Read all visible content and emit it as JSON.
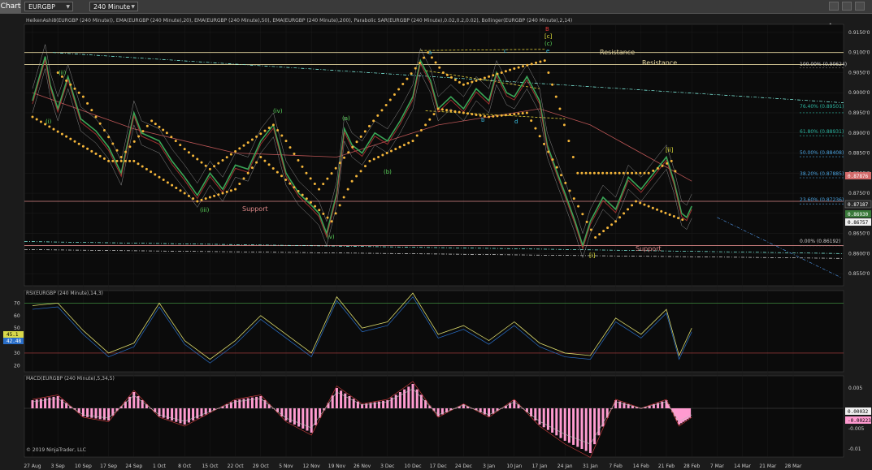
{
  "toolbar": {
    "tab_label": "Chart",
    "instrument": "EURGBP",
    "timeframe": "240 Minute"
  },
  "main_panel": {
    "indicator_header": "HeikenAshi8(EURGBP (240 Minute)), EMA(EURGBP (240 Minute),20), EMA(EURGBP (240 Minute),50), EMA(EURGBP (240 Minute),200), Parabolic SAR(EURGBP (240 Minute),0.02,0.2,0.02), Bollinger(EURGBP (240 Minute),2,14)",
    "y_ticks": [
      "0.9150'0",
      "0.9100'0",
      "0.9050'0",
      "0.9000'0",
      "0.8950'0",
      "0.8900'0",
      "0.8850'0",
      "0.8800'0",
      "0.8750'0",
      "0.8700'0",
      "0.8650'0",
      "0.8600'0",
      "0.8550'0"
    ],
    "price_labels": [
      "0.87876",
      "0.87187",
      "0.86930",
      "0.86757"
    ],
    "fib_levels": [
      {
        "label": "100.00% (0.90624)"
      },
      {
        "label": "76.40% (0.89501)"
      },
      {
        "label": "61.80% (0.88931)"
      },
      {
        "label": "50.00% (0.88408)"
      },
      {
        "label": "38.20% (0.87885)"
      },
      {
        "label": "23.60% (0.87236)"
      },
      {
        "label": "0.00% (0.86192)"
      }
    ],
    "lines": {
      "resistance_1": "Resistance",
      "resistance_2": "Resistance",
      "support_1": "Support",
      "support_2": "Support"
    },
    "wave_labels": {
      "i_top": "(i)",
      "i_bottom": "(ii)",
      "iii": "(iii)",
      "iv": "(iv)",
      "v": "(v)",
      "a": "(a)",
      "b": "(b)",
      "cyan_a": "a",
      "cyan_c": "c",
      "cyan_e": "e",
      "cyan_b": "b",
      "cyan_d": "d",
      "red_B": "B",
      "c_bracket": "[c]",
      "c_paren": "(c)",
      "i_bracket": "[i]",
      "ii_bracket": "[ii]"
    },
    "colors": {
      "sar": "#f5b63a",
      "support_line": "#d88",
      "resistance_line": "#e6d7a0",
      "trend_line": "#8fe",
      "fib_text": "#4aa3df",
      "wave_green": "#5cd65c",
      "wave_cyan": "#3cc3e6",
      "wave_red": "#e63c3c",
      "wave_yellow": "#e6e63c"
    }
  },
  "rsi_panel": {
    "title": "RSI(EURGBP (240 Minute),14,3)",
    "y_ticks": [
      "70",
      "60",
      "50",
      "40",
      "30",
      "20"
    ],
    "value_a": "45.1",
    "value_b": "42.48"
  },
  "macd_panel": {
    "title": "MACD(EURGBP (240 Minute),5,34,5)",
    "y_ticks": [
      "0.005",
      "-0.005",
      "-0.01"
    ],
    "value_a": "0.00032",
    "value_b": "-0.00223"
  },
  "copyright": "© 2019 NinjaTrader, LLC",
  "x_axis": {
    "ticks": [
      "27 Aug",
      "3 Sep",
      "10 Sep",
      "17 Sep",
      "24 Sep",
      "1 Oct",
      "8 Oct",
      "15 Oct",
      "22 Oct",
      "29 Oct",
      "5 Nov",
      "12 Nov",
      "19 Nov",
      "26 Nov",
      "3 Dec",
      "10 Dec",
      "17 Dec",
      "24 Dec",
      "3 Jan",
      "10 Jan",
      "17 Jan",
      "24 Jan",
      "31 Jan",
      "7 Feb",
      "14 Feb",
      "21 Feb",
      "28 Feb",
      "7 Mar",
      "14 Mar",
      "21 Mar",
      "28 Mar"
    ]
  },
  "chart_data": {
    "type": "line",
    "instrument": "EURGBP",
    "timeframe": "240 Minute",
    "x_unit": "weeks from 27 Aug",
    "price_path": [
      [
        0,
        0.898
      ],
      [
        0.5,
        0.909
      ],
      [
        0.7,
        0.902
      ],
      [
        1,
        0.896
      ],
      [
        1.4,
        0.904
      ],
      [
        1.9,
        0.8935
      ],
      [
        2.5,
        0.8905
      ],
      [
        3,
        0.8865
      ],
      [
        3.5,
        0.88
      ],
      [
        4,
        0.895
      ],
      [
        4.3,
        0.89
      ],
      [
        5,
        0.888
      ],
      [
        5.5,
        0.883
      ],
      [
        6,
        0.879
      ],
      [
        6.5,
        0.8745
      ],
      [
        7,
        0.88
      ],
      [
        7.5,
        0.876
      ],
      [
        8,
        0.882
      ],
      [
        8.5,
        0.881
      ],
      [
        9,
        0.888
      ],
      [
        9.5,
        0.892
      ],
      [
        10,
        0.88
      ],
      [
        10.5,
        0.875
      ],
      [
        11,
        0.872
      ],
      [
        11.3,
        0.87
      ],
      [
        11.6,
        0.865
      ],
      [
        12,
        0.875
      ],
      [
        12.3,
        0.891
      ],
      [
        12.6,
        0.887
      ],
      [
        13,
        0.885
      ],
      [
        13.5,
        0.89
      ],
      [
        14,
        0.888
      ],
      [
        14.5,
        0.893
      ],
      [
        15,
        0.899
      ],
      [
        15.3,
        0.908
      ],
      [
        15.7,
        0.903
      ],
      [
        16,
        0.896
      ],
      [
        16.5,
        0.899
      ],
      [
        17,
        0.896
      ],
      [
        17.5,
        0.901
      ],
      [
        18,
        0.898
      ],
      [
        18.3,
        0.905
      ],
      [
        18.7,
        0.9
      ],
      [
        19,
        0.899
      ],
      [
        19.5,
        0.904
      ],
      [
        20,
        0.898
      ],
      [
        20.3,
        0.887
      ],
      [
        20.7,
        0.88
      ],
      [
        21,
        0.875
      ],
      [
        21.4,
        0.868
      ],
      [
        21.7,
        0.862
      ],
      [
        22,
        0.868
      ],
      [
        22.5,
        0.874
      ],
      [
        23,
        0.871
      ],
      [
        23.5,
        0.879
      ],
      [
        24,
        0.876
      ],
      [
        24.5,
        0.88
      ],
      [
        25,
        0.884
      ],
      [
        25.3,
        0.878
      ],
      [
        25.6,
        0.87
      ],
      [
        25.8,
        0.869
      ],
      [
        26,
        0.8718
      ]
    ],
    "sar_upper": [
      [
        1,
        0.905
      ],
      [
        1.5,
        0.902
      ],
      [
        2,
        0.899
      ],
      [
        3.5,
        0.884
      ],
      [
        4.7,
        0.893
      ],
      [
        5.3,
        0.89
      ],
      [
        6,
        0.886
      ],
      [
        7,
        0.881
      ],
      [
        9.5,
        0.892
      ],
      [
        10,
        0.888
      ],
      [
        10.8,
        0.88
      ],
      [
        11.3,
        0.876
      ],
      [
        15.6,
        0.91
      ],
      [
        16.2,
        0.905
      ],
      [
        17,
        0.902
      ],
      [
        18,
        0.904
      ],
      [
        19,
        0.906
      ],
      [
        20.2,
        0.908
      ],
      [
        20.8,
        0.896
      ],
      [
        21.5,
        0.88
      ],
      [
        24.3,
        0.88
      ],
      [
        25.2,
        0.883
      ],
      [
        25.5,
        0.878
      ]
    ],
    "sar_lower": [
      [
        0,
        0.894
      ],
      [
        3,
        0.883
      ],
      [
        4,
        0.883
      ],
      [
        6.5,
        0.873
      ],
      [
        8,
        0.876
      ],
      [
        9,
        0.884
      ],
      [
        11.8,
        0.868
      ],
      [
        12.6,
        0.878
      ],
      [
        13.3,
        0.883
      ],
      [
        15,
        0.888
      ],
      [
        16,
        0.896
      ],
      [
        18,
        0.894
      ],
      [
        19.5,
        0.895
      ],
      [
        22.2,
        0.864
      ],
      [
        23,
        0.868
      ],
      [
        23.8,
        0.873
      ],
      [
        25.8,
        0.868
      ]
    ],
    "ema_200": [
      [
        0,
        0.9
      ],
      [
        4,
        0.891
      ],
      [
        8,
        0.885
      ],
      [
        12,
        0.884
      ],
      [
        16,
        0.892
      ],
      [
        20,
        0.896
      ],
      [
        22,
        0.892
      ],
      [
        24,
        0.885
      ],
      [
        26,
        0.878
      ]
    ],
    "resistance_levels": [
      0.91,
      0.907
    ],
    "support_levels": [
      0.873,
      0.862
    ],
    "rsi": [
      [
        0,
        68
      ],
      [
        1,
        70
      ],
      [
        2,
        48
      ],
      [
        3,
        30
      ],
      [
        4,
        38
      ],
      [
        5,
        70
      ],
      [
        6,
        40
      ],
      [
        7,
        25
      ],
      [
        8,
        40
      ],
      [
        9,
        60
      ],
      [
        10,
        45
      ],
      [
        11,
        30
      ],
      [
        12,
        75
      ],
      [
        13,
        50
      ],
      [
        14,
        55
      ],
      [
        15,
        78
      ],
      [
        16,
        45
      ],
      [
        17,
        52
      ],
      [
        18,
        40
      ],
      [
        19,
        55
      ],
      [
        20,
        38
      ],
      [
        21,
        30
      ],
      [
        22,
        28
      ],
      [
        23,
        58
      ],
      [
        24,
        45
      ],
      [
        25,
        65
      ],
      [
        25.5,
        28
      ],
      [
        26,
        50
      ]
    ],
    "macd": [
      [
        0,
        0.002
      ],
      [
        1,
        0.003
      ],
      [
        2,
        -0.002
      ],
      [
        3,
        -0.003
      ],
      [
        4,
        0.004
      ],
      [
        5,
        -0.002
      ],
      [
        6,
        -0.004
      ],
      [
        7,
        -0.001
      ],
      [
        8,
        0.002
      ],
      [
        9,
        0.003
      ],
      [
        10,
        -0.003
      ],
      [
        11,
        -0.006
      ],
      [
        12,
        0.005
      ],
      [
        13,
        0.001
      ],
      [
        14,
        0.002
      ],
      [
        15,
        0.006
      ],
      [
        16,
        -0.002
      ],
      [
        17,
        0.001
      ],
      [
        18,
        -0.002
      ],
      [
        19,
        0.002
      ],
      [
        20,
        -0.004
      ],
      [
        21,
        -0.008
      ],
      [
        22,
        -0.011
      ],
      [
        23,
        0.002
      ],
      [
        24,
        0
      ],
      [
        25,
        0.002
      ],
      [
        25.5,
        -0.004
      ],
      [
        26,
        -0.002
      ]
    ],
    "ylim_price": [
      0.852,
      0.917
    ],
    "ylim_rsi": [
      15,
      80
    ],
    "ylim_macd": [
      -0.012,
      0.008
    ]
  }
}
